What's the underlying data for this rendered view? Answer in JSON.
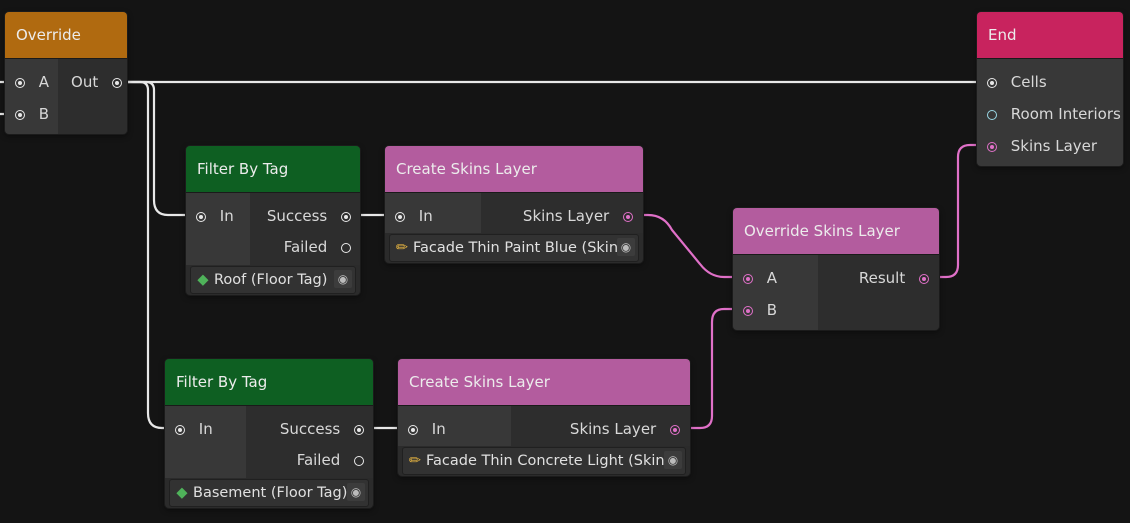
{
  "nodes": {
    "override": {
      "title": "Override",
      "inputs": [
        "A",
        "B"
      ],
      "output": "Out"
    },
    "filter1": {
      "title": "Filter By Tag",
      "input": "In",
      "outputs": [
        "Success",
        "Failed"
      ],
      "field": "Roof (Floor Tag)"
    },
    "skins1": {
      "title": "Create Skins Layer",
      "input": "In",
      "output": "Skins Layer",
      "field": "Facade Thin Paint Blue (Skin)"
    },
    "override_skins": {
      "title": "Override Skins Layer",
      "inputs": [
        "A",
        "B"
      ],
      "output": "Result"
    },
    "end": {
      "title": "End",
      "inputs": [
        "Cells",
        "Room Interiors",
        "Skins Layer"
      ]
    },
    "filter2": {
      "title": "Filter By Tag",
      "input": "In",
      "outputs": [
        "Success",
        "Failed"
      ],
      "field": "Basement (Floor Tag)"
    },
    "skins2": {
      "title": "Create Skins Layer",
      "input": "In",
      "output": "Skins Layer",
      "field": "Facade Thin Concrete Light (Skin)"
    }
  },
  "colors": {
    "background": "#141414",
    "override_header": "#b06a10",
    "filter_header": "#0e5f22",
    "skins_header": "#b35c9e",
    "end_header": "#c8235e",
    "skins_wire": "#e070c8",
    "generic_wire": "#e8e8e8",
    "tag_icon": "#4fb35a"
  },
  "icons": {
    "tag_field": "tag-icon",
    "skin_field": "paintbrush-icon",
    "picker": "target-picker-icon"
  }
}
